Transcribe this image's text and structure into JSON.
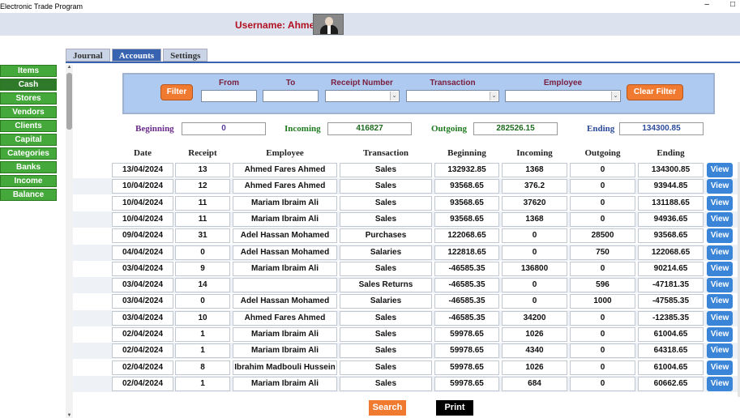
{
  "window": {
    "title": "Electronic Trade Program",
    "minimize": "–",
    "restore": "□"
  },
  "user": {
    "label": "Username: Ahmed"
  },
  "tabs": [
    {
      "label": "Journal",
      "active": false
    },
    {
      "label": "Accounts",
      "active": true
    },
    {
      "label": "Settings",
      "active": false
    }
  ],
  "sidebar": {
    "items": [
      {
        "label": "Items"
      },
      {
        "label": "Cash"
      },
      {
        "label": "Stores"
      },
      {
        "label": "Vendors"
      },
      {
        "label": "Clients"
      },
      {
        "label": "Capital"
      },
      {
        "label": "Categories"
      },
      {
        "label": "Banks"
      },
      {
        "label": "Income"
      },
      {
        "label": "Balance"
      }
    ],
    "active_index": 1
  },
  "filter": {
    "filter_label": "Filter",
    "clear_label": "Clear Filter",
    "from_label": "From",
    "to_label": "To",
    "receipt_label": "Receipt Number",
    "transaction_label": "Transaction",
    "employee_label": "Employee",
    "from_value": "",
    "to_value": "",
    "receipt_value": "",
    "transaction_value": "",
    "employee_value": ""
  },
  "summary": {
    "beginning_label": "Beginning",
    "beginning_value": "0",
    "incoming_label": "Incoming",
    "incoming_value": "416827",
    "outgoing_label": "Outgoing",
    "outgoing_value": "282526.15",
    "ending_label": "Ending",
    "ending_value": "134300.85"
  },
  "table": {
    "headers": [
      "Date",
      "Receipt",
      "Employee",
      "Transaction",
      "Beginning",
      "Incoming",
      "Outgoing",
      "Ending"
    ],
    "view_label": "View",
    "rows": [
      [
        "13/04/2024",
        "13",
        "Ahmed Fares Ahmed",
        "Sales",
        "132932.85",
        "1368",
        "0",
        "134300.85"
      ],
      [
        "10/04/2024",
        "12",
        "Ahmed Fares Ahmed",
        "Sales",
        "93568.65",
        "376.2",
        "0",
        "93944.85"
      ],
      [
        "10/04/2024",
        "11",
        "Mariam Ibraim Ali",
        "Sales",
        "93568.65",
        "37620",
        "0",
        "131188.65"
      ],
      [
        "10/04/2024",
        "11",
        "Mariam Ibraim Ali",
        "Sales",
        "93568.65",
        "1368",
        "0",
        "94936.65"
      ],
      [
        "09/04/2024",
        "31",
        "Adel Hassan Mohamed",
        "Purchases",
        "122068.65",
        "0",
        "28500",
        "93568.65"
      ],
      [
        "04/04/2024",
        "0",
        "Adel Hassan Mohamed",
        "Salaries",
        "122818.65",
        "0",
        "750",
        "122068.65"
      ],
      [
        "03/04/2024",
        "9",
        "Mariam Ibraim Ali",
        "Sales",
        "-46585.35",
        "136800",
        "0",
        "90214.65"
      ],
      [
        "03/04/2024",
        "14",
        "",
        "Sales Returns",
        "-46585.35",
        "0",
        "596",
        "-47181.35"
      ],
      [
        "03/04/2024",
        "0",
        "Adel Hassan Mohamed",
        "Salaries",
        "-46585.35",
        "0",
        "1000",
        "-47585.35"
      ],
      [
        "03/04/2024",
        "10",
        "Ahmed Fares Ahmed",
        "Sales",
        "-46585.35",
        "34200",
        "0",
        "-12385.35"
      ],
      [
        "02/04/2024",
        "1",
        "Mariam Ibraim Ali",
        "Sales",
        "59978.65",
        "1026",
        "0",
        "61004.65"
      ],
      [
        "02/04/2024",
        "1",
        "Mariam Ibraim Ali",
        "Sales",
        "59978.65",
        "4340",
        "0",
        "64318.65"
      ],
      [
        "02/04/2024",
        "8",
        "Ibrahim Madbouli Hussein",
        "Sales",
        "59978.65",
        "1026",
        "0",
        "61004.65"
      ],
      [
        "02/04/2024",
        "1",
        "Mariam Ibraim Ali",
        "Sales",
        "59978.65",
        "684",
        "0",
        "60662.65"
      ]
    ]
  },
  "actions": {
    "search_label": "Search",
    "print_label": "Print"
  },
  "colors": {
    "accent": "#3763b0",
    "sidebar_green": "#44a83a",
    "orange": "#f07a30",
    "view_blue": "#3b85d8",
    "username_red": "#b01020"
  }
}
